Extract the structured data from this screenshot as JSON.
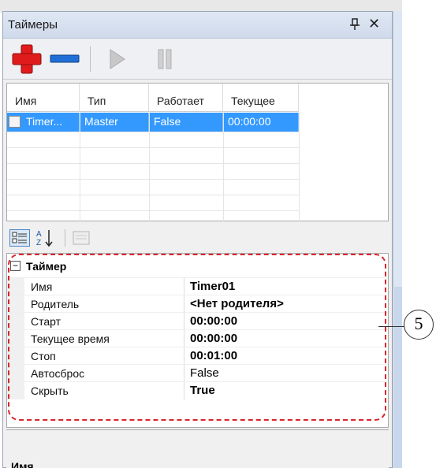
{
  "panel": {
    "title": "Таймеры",
    "pin_icon": "pin-icon",
    "close_icon": "close-icon"
  },
  "toolbar": {
    "add_icon": "add-timer-icon",
    "remove_icon": "remove-timer-icon",
    "play_icon": "play-icon",
    "pause_icon": "pause-icon"
  },
  "grid": {
    "columns": [
      "Имя",
      "Тип",
      "Работает",
      "Текущее"
    ],
    "rows": [
      {
        "checked": false,
        "name": "Timer...",
        "type": "Master",
        "running": "False",
        "current": "00:00:00"
      }
    ]
  },
  "prop_toolbar": {
    "categorized_icon": "categorized-icon",
    "alphabetical_label": "A↓",
    "property_pages_icon": "property-pages-icon"
  },
  "properties": {
    "category": "Таймер",
    "expand_symbol": "−",
    "items": [
      {
        "name": "Имя",
        "value": "Timer01",
        "bold": true
      },
      {
        "name": "Родитель",
        "value": "<Нет родителя>",
        "bold": true
      },
      {
        "name": "Старт",
        "value": "00:00:00",
        "bold": true
      },
      {
        "name": "Текущее время",
        "value": "00:00:00",
        "bold": true
      },
      {
        "name": "Стоп",
        "value": "00:01:00",
        "bold": true
      },
      {
        "name": "Автосброс",
        "value": "False",
        "bold": false
      },
      {
        "name": "Скрыть",
        "value": "True",
        "bold": true
      }
    ]
  },
  "help": {
    "title": "Имя"
  },
  "callout": {
    "number": "5",
    "color": "#d9252c"
  },
  "colors": {
    "selection": "#3399ff",
    "add_red": "#e01b1b",
    "remove_blue": "#1f6fd6"
  }
}
